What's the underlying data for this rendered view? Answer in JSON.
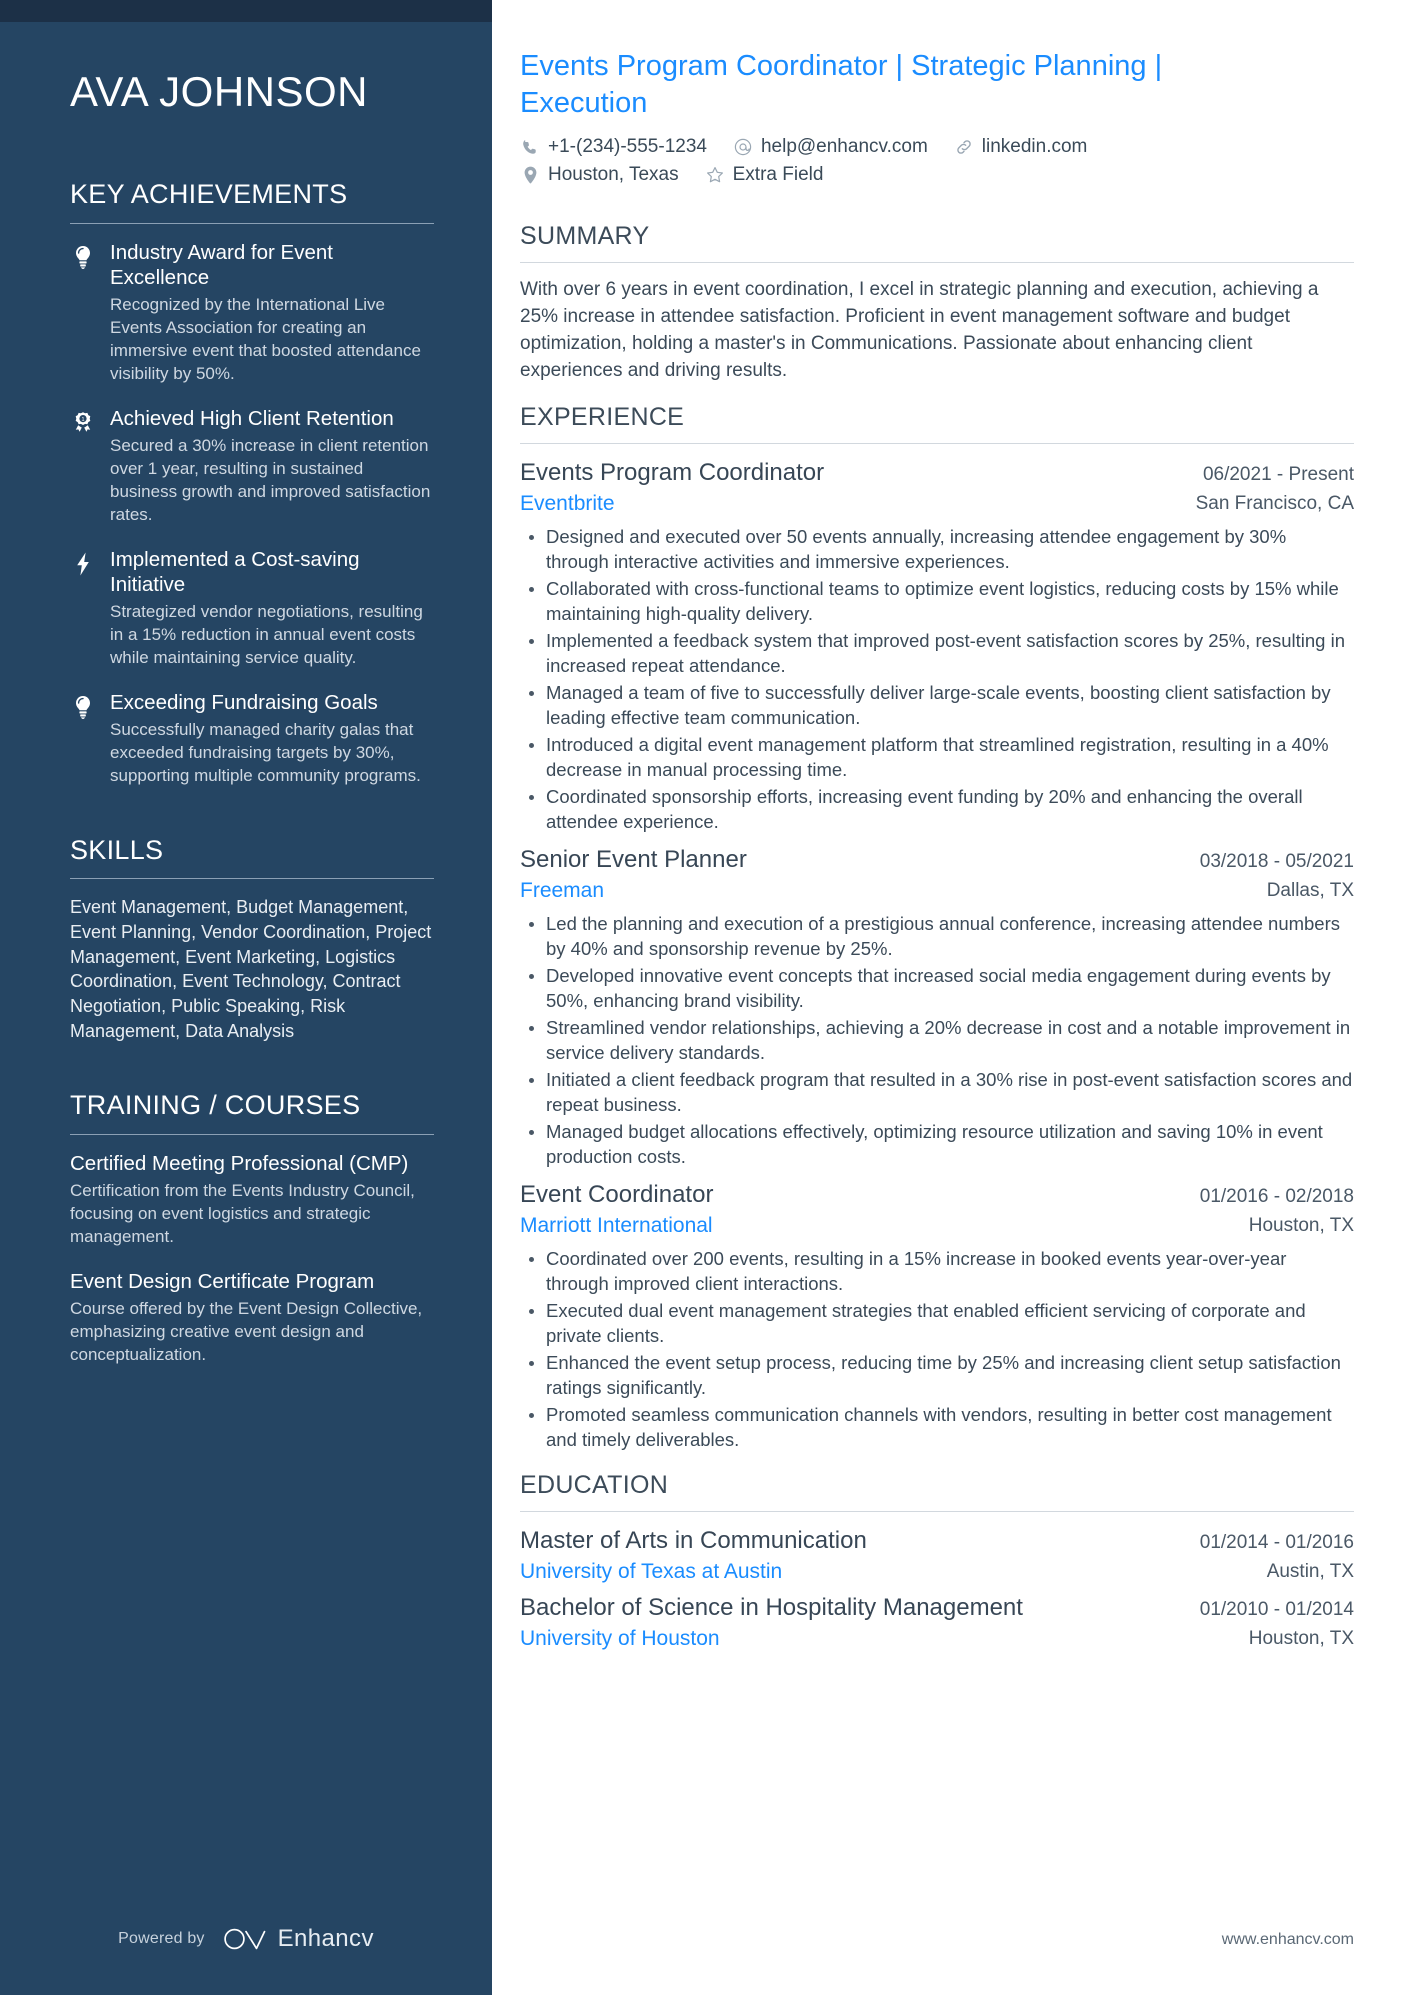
{
  "sidebar": {
    "name": "AVA JOHNSON",
    "key_achievements": {
      "heading": "KEY ACHIEVEMENTS",
      "items": [
        {
          "icon": "lightbulb-icon",
          "title": "Industry Award for Event Excellence",
          "description": "Recognized by the International Live Events Association for creating an immersive event that boosted attendance visibility by 50%."
        },
        {
          "icon": "award-ribbon-icon",
          "title": "Achieved High Client Retention",
          "description": "Secured a 30% increase in client retention over 1 year, resulting in sustained business growth and improved satisfaction rates."
        },
        {
          "icon": "lightning-bolt-icon",
          "title": "Implemented a Cost-saving Initiative",
          "description": "Strategized vendor negotiations, resulting in a 15% reduction in annual event costs while maintaining service quality."
        },
        {
          "icon": "lightbulb-icon",
          "title": "Exceeding Fundraising Goals",
          "description": "Successfully managed charity galas that exceeded fundraising targets by 30%, supporting multiple community programs."
        }
      ]
    },
    "skills": {
      "heading": "SKILLS",
      "text": "Event Management, Budget Management, Event Planning, Vendor Coordination, Project Management, Event Marketing, Logistics Coordination, Event Technology, Contract Negotiation, Public Speaking, Risk Management, Data Analysis"
    },
    "training": {
      "heading": "TRAINING / COURSES",
      "items": [
        {
          "title": "Certified Meeting Professional (CMP)",
          "description": "Certification from the Events Industry Council, focusing on event logistics and strategic management."
        },
        {
          "title": "Event Design Certificate Program",
          "description": "Course offered by the Event Design Collective, emphasizing creative event design and conceptualization."
        }
      ]
    },
    "footer": {
      "powered_by": "Powered by",
      "brand": "Enhancv"
    }
  },
  "main": {
    "headline": "Events Program Coordinator | Strategic Planning | Execution",
    "contact": {
      "row1": [
        {
          "icon": "phone-icon",
          "text": "+1-(234)-555-1234"
        },
        {
          "icon": "at-sign-icon",
          "text": "help@enhancv.com"
        },
        {
          "icon": "link-icon",
          "text": "linkedin.com"
        }
      ],
      "row2": [
        {
          "icon": "location-pin-icon",
          "text": "Houston, Texas"
        },
        {
          "icon": "star-icon",
          "text": "Extra Field"
        }
      ]
    },
    "summary": {
      "heading": "SUMMARY",
      "text": "With over 6 years in event coordination, I excel in strategic planning and execution, achieving a 25% increase in attendee satisfaction. Proficient in event management software and budget optimization, holding a master's in Communications. Passionate about enhancing client experiences and driving results."
    },
    "experience": {
      "heading": "EXPERIENCE",
      "entries": [
        {
          "title": "Events Program Coordinator",
          "date": "06/2021 - Present",
          "org": "Eventbrite",
          "location": "San Francisco, CA",
          "bullets": [
            "Designed and executed over 50 events annually, increasing attendee engagement by 30% through interactive activities and immersive experiences.",
            "Collaborated with cross-functional teams to optimize event logistics, reducing costs by 15% while maintaining high-quality delivery.",
            "Implemented a feedback system that improved post-event satisfaction scores by 25%, resulting in increased repeat attendance.",
            "Managed a team of five to successfully deliver large-scale events, boosting client satisfaction by leading effective team communication.",
            "Introduced a digital event management platform that streamlined registration, resulting in a 40% decrease in manual processing time.",
            "Coordinated sponsorship efforts, increasing event funding by 20% and enhancing the overall attendee experience."
          ]
        },
        {
          "title": "Senior Event Planner",
          "date": "03/2018 - 05/2021",
          "org": "Freeman",
          "location": "Dallas, TX",
          "bullets": [
            "Led the planning and execution of a prestigious annual conference, increasing attendee numbers by 40% and sponsorship revenue by 25%.",
            "Developed innovative event concepts that increased social media engagement during events by 50%, enhancing brand visibility.",
            "Streamlined vendor relationships, achieving a 20% decrease in cost and a notable improvement in service delivery standards.",
            "Initiated a client feedback program that resulted in a 30% rise in post-event satisfaction scores and repeat business.",
            "Managed budget allocations effectively, optimizing resource utilization and saving 10% in event production costs."
          ]
        },
        {
          "title": "Event Coordinator",
          "date": "01/2016 - 02/2018",
          "org": "Marriott International",
          "location": "Houston, TX",
          "bullets": [
            "Coordinated over 200 events, resulting in a 15% increase in booked events year-over-year through improved client interactions.",
            "Executed dual event management strategies that enabled efficient servicing of corporate and private clients.",
            "Enhanced the event setup process, reducing time by 25% and increasing client setup satisfaction ratings significantly.",
            "Promoted seamless communication channels with vendors, resulting in better cost management and timely deliverables."
          ]
        }
      ]
    },
    "education": {
      "heading": "EDUCATION",
      "entries": [
        {
          "title": "Master of Arts in Communication",
          "date": "01/2014 - 01/2016",
          "org": "University of Texas at Austin",
          "location": "Austin, TX"
        },
        {
          "title": "Bachelor of Science in Hospitality Management",
          "date": "01/2010 - 01/2014",
          "org": "University of Houston",
          "location": "Houston, TX"
        }
      ]
    },
    "footer": {
      "website": "www.enhancv.com"
    }
  },
  "colors": {
    "sidebar_bg": "#254563",
    "sidebar_topstrip": "#1c3047",
    "accent_blue": "#1a8cff",
    "body_text": "#3b4a58"
  }
}
